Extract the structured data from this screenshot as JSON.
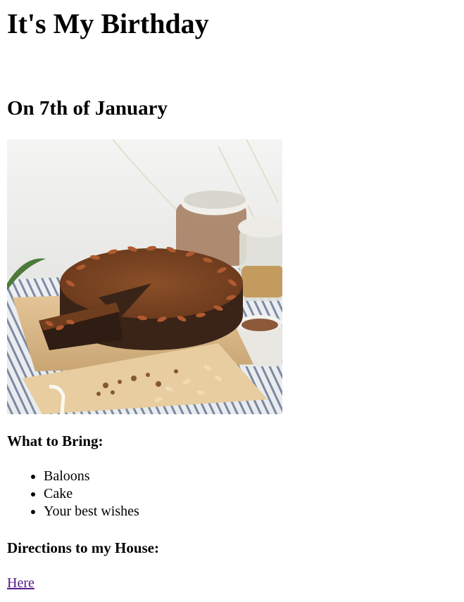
{
  "page": {
    "title": "It's My Birthday",
    "date_heading": "On 7th of January",
    "bring_heading": "What to Bring:",
    "bring_items": [
      "Baloons",
      "Cake",
      "Your best wishes"
    ],
    "directions_heading": "Directions to my House:",
    "directions_link": "Here"
  },
  "colors": {
    "visited_link": "#551a8b",
    "text": "#000000",
    "background": "#ffffff"
  }
}
